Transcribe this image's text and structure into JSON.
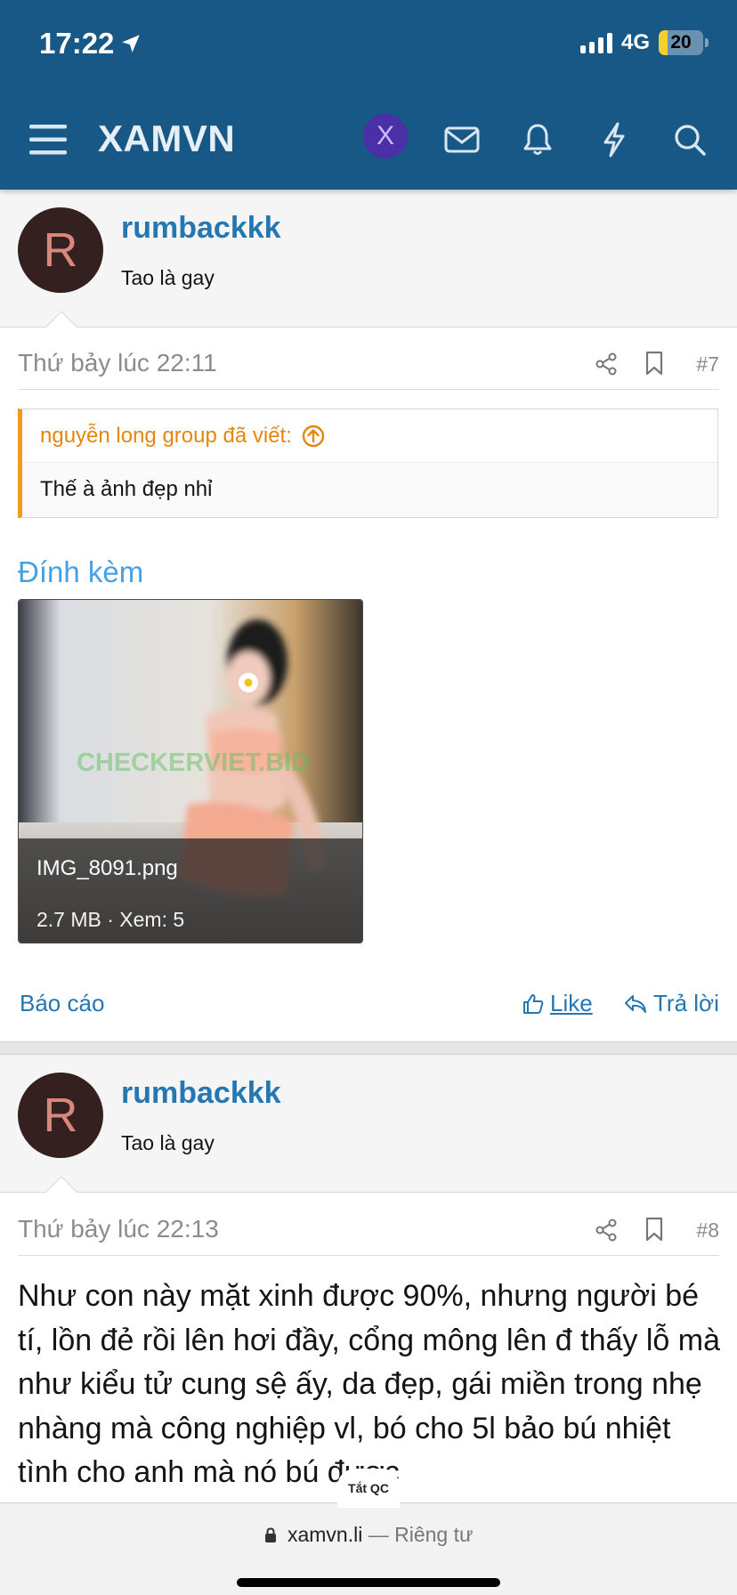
{
  "status_bar": {
    "time": "17:22",
    "network": "4G",
    "battery": "20",
    "battery_level": 0.2,
    "colors": {
      "battery_fill": "#f5cf2f"
    },
    "icons": [
      "location-arrow-icon",
      "signal-bars-icon",
      "battery-icon"
    ]
  },
  "header": {
    "title": "XAMVN",
    "avatar_letter": "X",
    "icons": [
      "menu-icon",
      "user-avatar",
      "mail-icon",
      "bell-icon",
      "lightning-icon",
      "search-icon"
    ],
    "colors": {
      "background": "#185886",
      "avatar": "#4a2fa6"
    }
  },
  "posts": [
    {
      "author": "rumbackkk",
      "avatar_letter": "R",
      "user_title": "Tao là gay",
      "date": "Thứ bảy lúc 22:11",
      "number": "#7",
      "quote": {
        "author": "nguyễn long group đã viết:",
        "text": "Thế à ảnh đẹp nhỉ"
      },
      "attachments_label": "Đính kèm",
      "attachment": {
        "filename": "IMG_8091.png",
        "meta": "2.7 MB · Xem: 5",
        "watermark": "CHECKERVIET.BID"
      },
      "actions": {
        "report": "Báo cáo",
        "like": "Like",
        "reply": "Trả lời"
      }
    },
    {
      "author": "rumbackkk",
      "avatar_letter": "R",
      "user_title": "Tao là gay",
      "date": "Thứ bảy lúc 22:13",
      "number": "#8",
      "body": "Như con này mặt xinh được 90%, nhưng người bé tí, lồn đẻ rồi lên hơi đầy, cổng mông lên đ thấy lỗ mà như kiểu tử cung sệ ấy, da đẹp, gái miền trong nhẹ nhàng mà công nghiệp vl, bó cho 5l bảo bú nhiệt tình cho anh mà nó bú được"
    }
  ],
  "ad_tab": "Tắt QC",
  "browser": {
    "url": "xamvn.li",
    "separator": "—",
    "mode": "Riêng tư"
  },
  "colors": {
    "link": "#2577b1",
    "quote_accent": "#f29a1f",
    "quote_author": "#e4870f",
    "attachments_heading": "#46a1e4",
    "avatar_bg": "#33201f",
    "avatar_letter": "#d9867c"
  }
}
